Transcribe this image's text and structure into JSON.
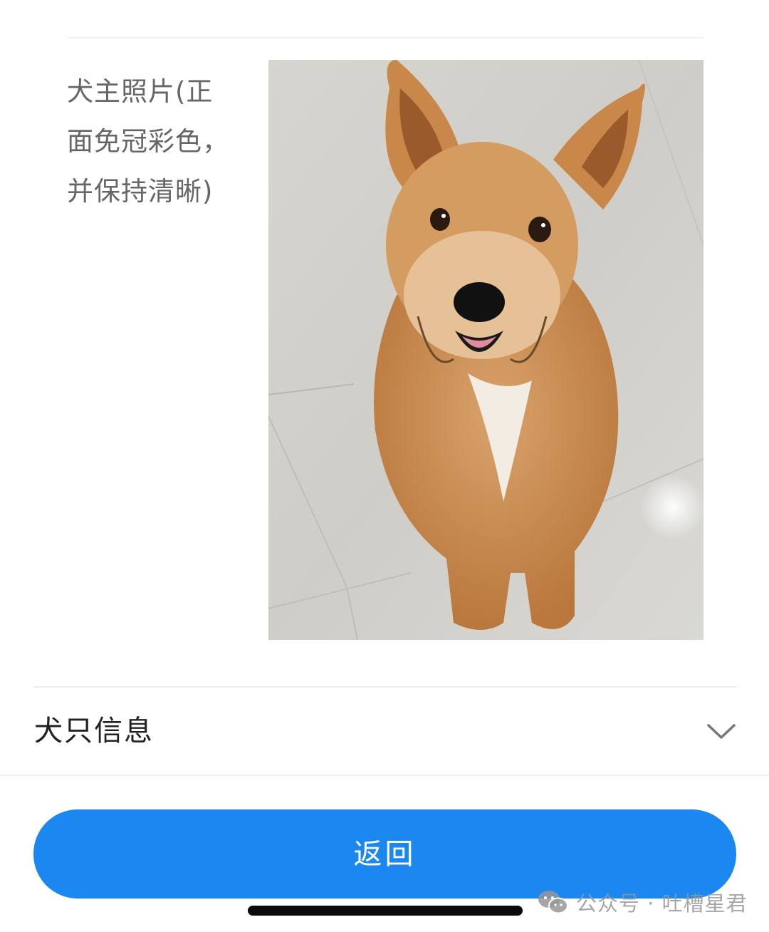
{
  "photo_section": {
    "label": "犬主照片(正面免冠彩色，并保持清晰)"
  },
  "dog_info": {
    "title": "犬只信息",
    "icon": "chevron-down-icon"
  },
  "actions": {
    "back_label": "返回"
  },
  "watermark": {
    "text": "公众号 · 吐槽星君",
    "icon": "wechat-icon"
  },
  "colors": {
    "primary": "#1a88f0",
    "label_gray": "#666666",
    "title_dark": "#222222"
  }
}
